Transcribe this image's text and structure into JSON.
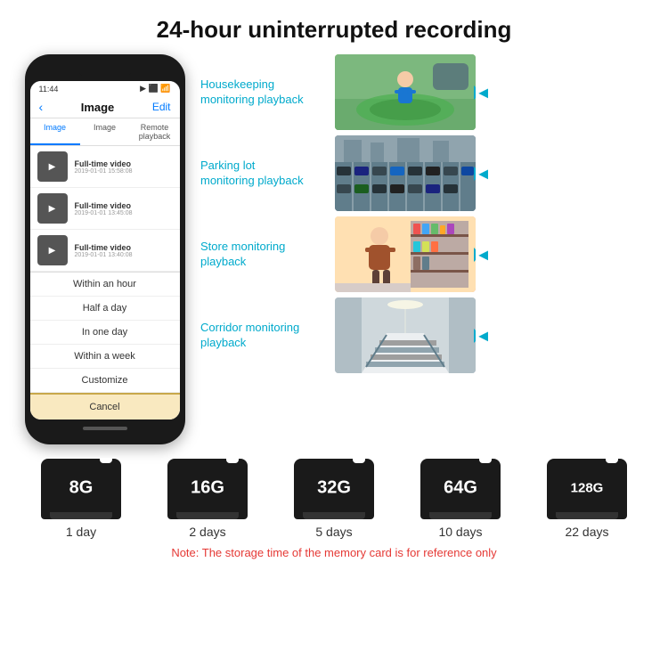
{
  "title": "24-hour uninterrupted recording",
  "phone": {
    "time": "11:44",
    "screen_title": "Image",
    "edit_label": "Edit",
    "back_arrow": "‹",
    "tabs": [
      "Image",
      "Image",
      "Remote playback"
    ],
    "active_tab_index": 0,
    "video_items": [
      {
        "title": "Full-time video",
        "date": "2019-01-01 15:58:08"
      },
      {
        "title": "Full-time video",
        "date": "2019-01-01 13:45:08"
      },
      {
        "title": "Full-time video",
        "date": "2019-01-01 13:40:08"
      }
    ],
    "dropdown_items": [
      "Within an hour",
      "Half a day",
      "In one day",
      "Within a week",
      "Customize"
    ],
    "cancel_label": "Cancel"
  },
  "monitoring": [
    {
      "label": "Housekeeping\nmonitoring playback",
      "img_class": "img-housekeeping",
      "icon": "🧒"
    },
    {
      "label": "Parking lot\nmonitoring playback",
      "img_class": "img-parking",
      "icon": "🚗"
    },
    {
      "label": "Store monitoring\nplayback",
      "img_class": "img-store",
      "icon": "🧑"
    },
    {
      "label": "Corridor monitoring\nplayback",
      "img_class": "img-corridor",
      "icon": "🏠"
    }
  ],
  "storage": {
    "cards": [
      {
        "size": "8G",
        "days": "1 day"
      },
      {
        "size": "16G",
        "days": "2 days"
      },
      {
        "size": "32G",
        "days": "5 days"
      },
      {
        "size": "64G",
        "days": "10 days"
      },
      {
        "size": "128G",
        "days": "22 days"
      }
    ],
    "note": "Note: The storage time of the memory card is for reference only"
  }
}
